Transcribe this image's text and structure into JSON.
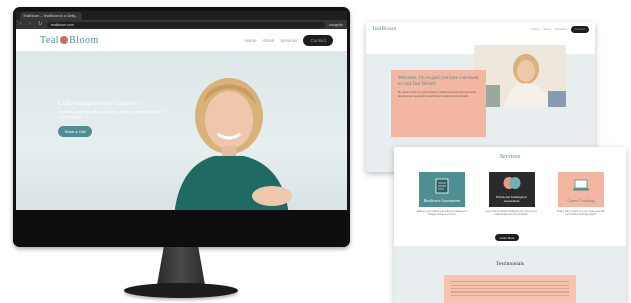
{
  "browser": {
    "tab_title": "TealBloom – TealBloom is a Getty...",
    "url": "tealbloom.com",
    "profile_label": "Incognito"
  },
  "site": {
    "logo_text_left": "Teal",
    "logo_text_right": "Bloom",
    "nav": [
      "Home",
      "About",
      "Services"
    ],
    "contact_label": "Contact",
    "hero_title": "Cultivating career success",
    "hero_subtitle": "Providing career-building services to ensure maximum success and resiliency.",
    "hero_cta": "Book a Call"
  },
  "about_page": {
    "logo": "TealBloom",
    "nav": [
      "Home",
      "About",
      "Services"
    ],
    "contact_label": "Contact",
    "title": "Welcome, I'm so glad you have a moment to visit Teal Bloom!",
    "paragraph": "My name is Liza, I'm your partner in building success through career development, leadership coaching and organizational growth."
  },
  "services_page": {
    "title": "Services",
    "cards": [
      {
        "label": "Resilience Assessment",
        "icon": "clipboard-icon",
        "style": "teal"
      },
      {
        "label": "Emotional Intelligence Assessment",
        "icon": "brain-icon",
        "style": "dark"
      },
      {
        "label": "Career Coaching",
        "icon": "laptop-icon",
        "style": "salmon"
      }
    ],
    "descriptions": [
      "Measure your resiliency and develop strategies to manage change and stress.",
      "Learn how emotional intelligence can improve your relationships and communication.",
      "Build a plan to reach your next career goal with personalized coaching support."
    ],
    "learn_more": "Learn More",
    "testimonials_title": "Testimonials"
  },
  "colors": {
    "teal": "#4f8f94",
    "salmon": "#f3b6a0",
    "dark": "#1e1e1e",
    "hero_bg": "#e0e9ec"
  }
}
